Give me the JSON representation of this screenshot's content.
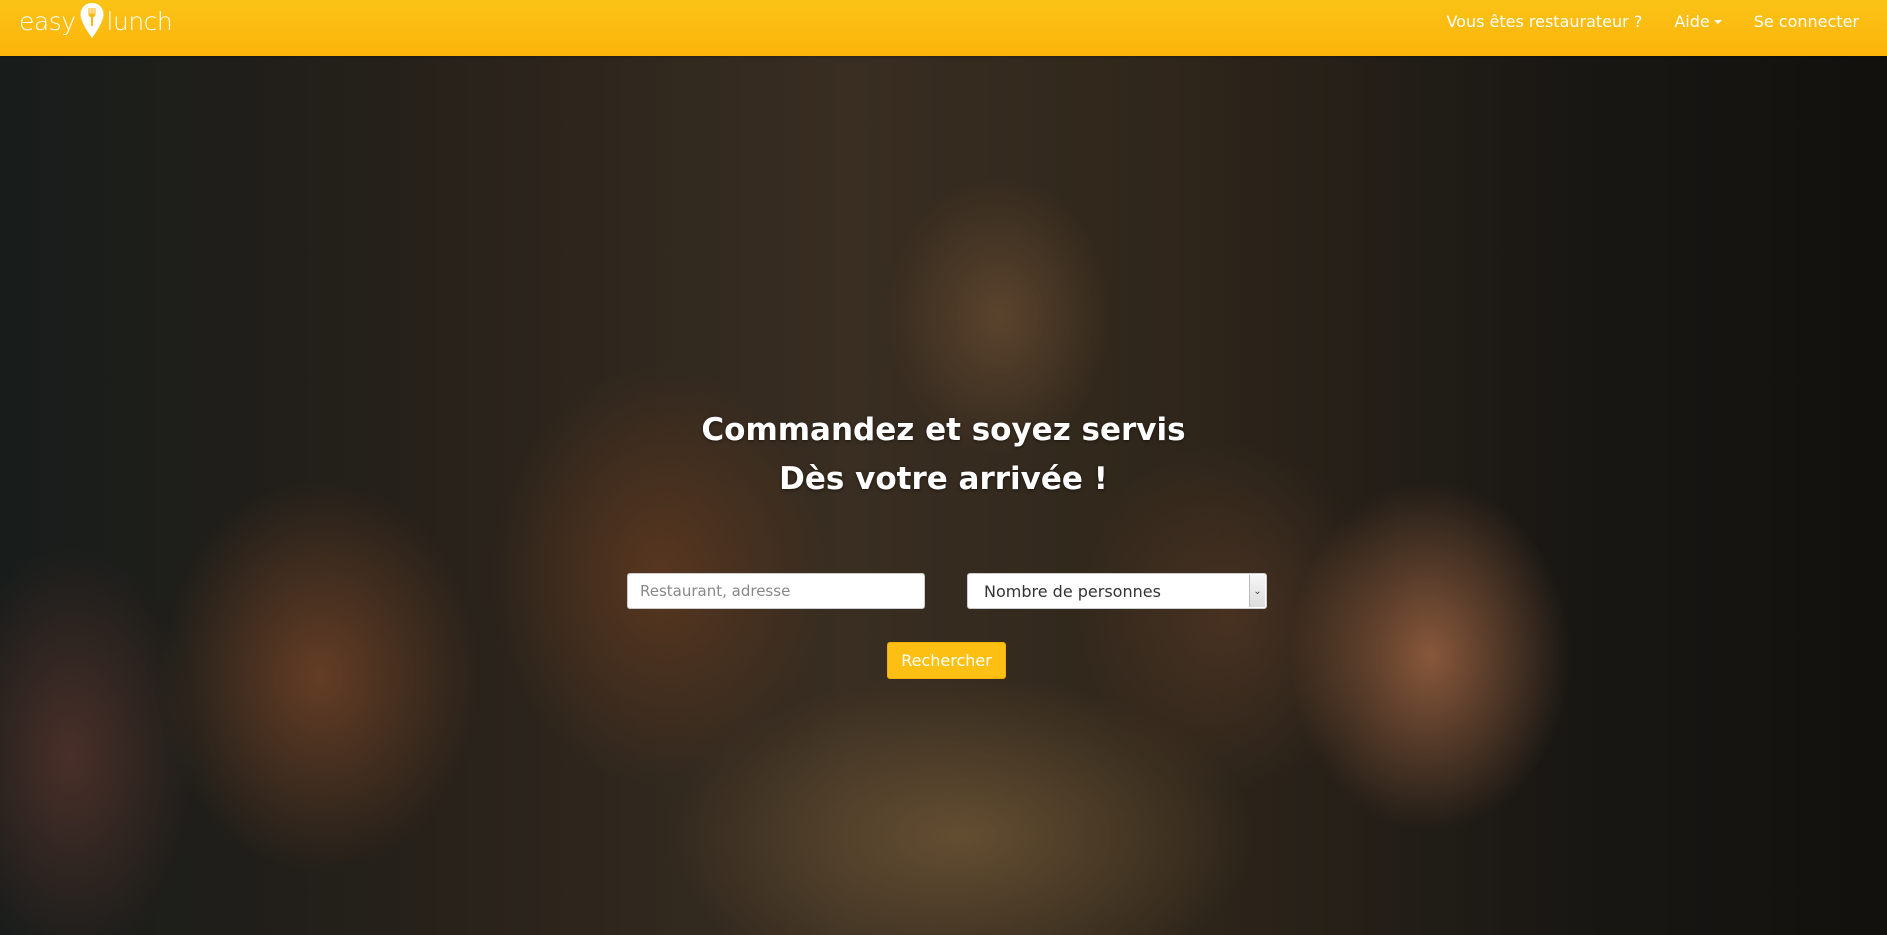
{
  "navbar": {
    "logo": {
      "left": "easy",
      "right": "lunch"
    },
    "links": {
      "restaurateur": "Vous êtes restaurateur ?",
      "aide": "Aide",
      "connect": "Se connecter"
    }
  },
  "hero": {
    "headline_line1": "Commandez et soyez servis",
    "headline_line2": "Dès votre arrivée !",
    "search_placeholder": "Restaurant, adresse",
    "select_value": "Nombre de personnes",
    "button_label": "Rechercher"
  },
  "colors": {
    "navbar": "#fbc317",
    "accent_button": "#fcbf12",
    "text_light": "#ffffff"
  },
  "icons": {
    "logo_pin": "map-pin-fork-icon",
    "dropdown_caret": "caret-down-icon",
    "select_arrow": "chevron-down-icon"
  }
}
